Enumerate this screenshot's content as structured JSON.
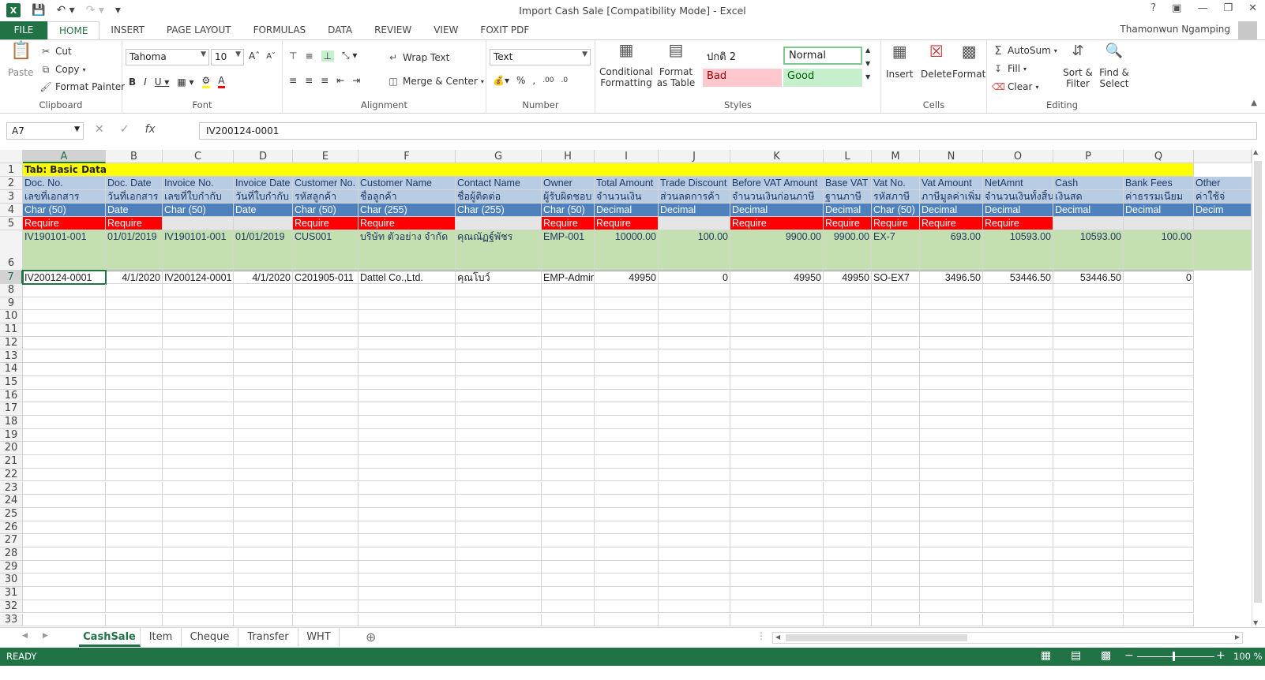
{
  "title_bar": {
    "title": "Import Cash Sale  [Compatibility Mode] - Excel",
    "user": "Thamonwun Ngamping"
  },
  "tabs": [
    "FILE",
    "HOME",
    "INSERT",
    "PAGE LAYOUT",
    "FORMULAS",
    "DATA",
    "REVIEW",
    "VIEW",
    "FOXIT PDF"
  ],
  "ribbon": {
    "clipboard": {
      "label": "Clipboard",
      "paste": "Paste",
      "cut": "Cut",
      "copy": "Copy",
      "format_painter": "Format Painter"
    },
    "font": {
      "label": "Font",
      "name": "Tahoma",
      "size": "10"
    },
    "alignment": {
      "label": "Alignment",
      "wrap": "Wrap Text",
      "merge": "Merge & Center"
    },
    "number": {
      "label": "Number",
      "format": "Text"
    },
    "styles": {
      "label": "Styles",
      "conditional": "Conditional Formatting",
      "format_table": "Format as Table",
      "style1": "ปกติ 2",
      "normal": "Normal",
      "bad": "Bad",
      "good": "Good"
    },
    "cells": {
      "label": "Cells",
      "insert": "Insert",
      "delete": "Delete",
      "format": "Format"
    },
    "editing": {
      "label": "Editing",
      "autosum": "AutoSum",
      "fill": "Fill",
      "clear": "Clear",
      "sort": "Sort & Filter",
      "find": "Find & Select"
    }
  },
  "formula_bar": {
    "namebox": "A7",
    "formula": "IV200124-0001"
  },
  "columns": [
    "A",
    "B",
    "C",
    "D",
    "E",
    "F",
    "G",
    "H",
    "I",
    "J",
    "K",
    "L",
    "M",
    "N",
    "O",
    "P",
    "Q",
    ""
  ],
  "rows": {
    "r1": "Tab: Basic Data",
    "r2": [
      "Doc. No.",
      "Doc. Date",
      "Invoice No.",
      "Invoice Date",
      "Customer No.",
      "Customer Name",
      "Contact Name",
      "Owner",
      "Total Amount",
      "Trade Discount",
      "Before VAT Amount",
      "Base VAT",
      "Vat No.",
      "Vat Amount",
      "NetAmnt",
      "Cash",
      "Bank Fees",
      "Other"
    ],
    "r3": [
      "เลขที่เอกสาร",
      "วันที่เอกสาร",
      "เลขที่ใบกำกับ",
      "วันที่ใบกำกับ",
      "รหัสลูกค้า",
      "ชื่อลูกค้า",
      "ชื่อผู้ติดต่อ",
      "ผู้รับผิดชอบ",
      "จำนวนเงิน",
      "ส่วนลดการค้า",
      "จำนวนเงินก่อนภาษี",
      "ฐานภาษี",
      "รหัสภาษี",
      "ภาษีมูลค่าเพิ่ม",
      "จำนวนเงินทั้งสิ้น",
      "เงินสด",
      "ค่าธรรมเนียม",
      "ค่าใช้จ่"
    ],
    "r4": [
      "Char (50)",
      "Date",
      "Char (50)",
      "Date",
      "Char (50)",
      "Char (255)",
      "Char (255)",
      "Char (50)",
      "Decimal",
      "Decimal",
      "Decimal",
      "Decimal",
      "Char (50)",
      "Decimal",
      "Decimal",
      "Decimal",
      "Decimal",
      "Decim"
    ],
    "r5": [
      "Require",
      "Require",
      "",
      "",
      "Require",
      "Require",
      "",
      "Require",
      "Require",
      "",
      "Require",
      "Require",
      "Require",
      "Require",
      "Require",
      "",
      "",
      ""
    ],
    "r6": [
      "IV190101-001",
      "01/01/2019",
      "IV190101-001",
      "01/01/2019",
      "CUS001",
      "บริษัท ตัวอย่าง จำกัด",
      "คุณณัฏฐ์พัชร",
      "EMP-001",
      "10000.00",
      "100.00",
      "9900.00",
      "9900.00",
      "EX-7",
      "693.00",
      "10593.00",
      "10593.00",
      "100.00",
      ""
    ],
    "r7": [
      "IV200124-0001",
      "4/1/2020",
      "IV200124-0001",
      "4/1/2020",
      "C201905-011",
      "Dattel Co.,Ltd.",
      "คุณโบว์",
      "EMP-Admin",
      "49950",
      "0",
      "49950",
      "49950",
      "SO-EX7",
      "3496.50",
      "53446.50",
      "53446.50",
      "0",
      ""
    ]
  },
  "row_numbers": [
    "1",
    "2",
    "3",
    "4",
    "5",
    "6",
    "7",
    "8",
    "9",
    "10",
    "11",
    "12",
    "13",
    "14",
    "15",
    "16",
    "17",
    "18",
    "19",
    "20",
    "21",
    "22",
    "23",
    "24",
    "25",
    "26",
    "27",
    "28",
    "29",
    "30",
    "31",
    "32",
    "33"
  ],
  "sheets": [
    "CashSale",
    "Item",
    "Cheque",
    "Transfer",
    "WHT"
  ],
  "status": {
    "mode": "READY",
    "zoom": "100 %"
  },
  "colors": {
    "excel_green": "#217346",
    "yellow": "#ffff00",
    "header_blue": "#b8cce4",
    "type_blue": "#4f81bd",
    "require_red": "#ff0000",
    "sample_green": "#c4dfb0"
  }
}
